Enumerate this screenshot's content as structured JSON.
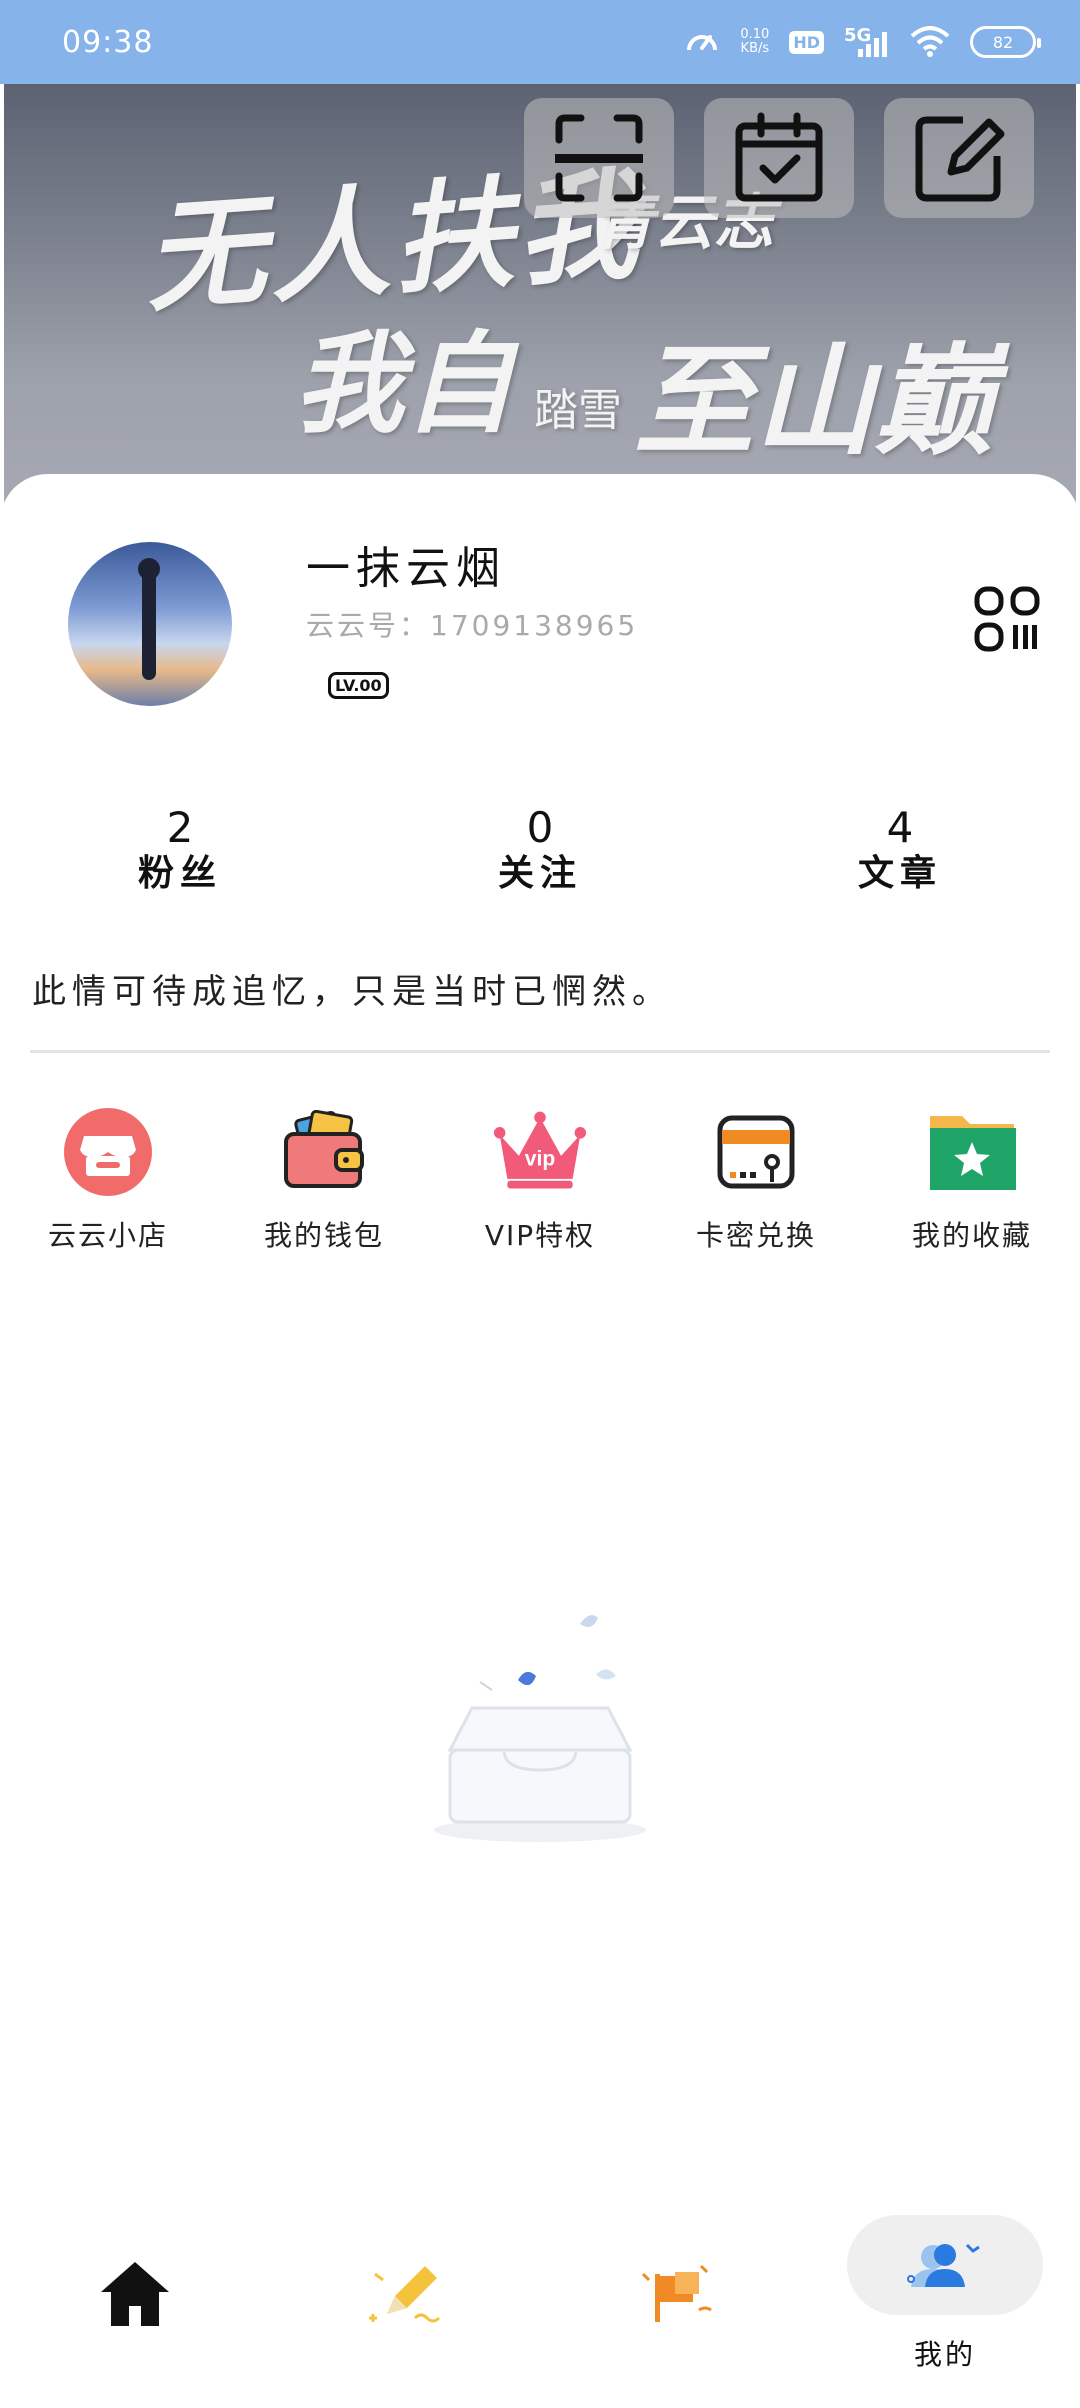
{
  "status_bar": {
    "time": "09:38",
    "net_speed": "0.10",
    "net_unit": "KB/s",
    "hd_badge": "HD",
    "network": "5G",
    "battery": "82"
  },
  "banner": {
    "line1": "无人扶我",
    "line1_small": "青云志",
    "line2": "我自",
    "line2_small": "踏雪",
    "line3": "至山巅"
  },
  "top_actions": [
    {
      "icon": "scan-icon"
    },
    {
      "icon": "calendar-check-icon"
    },
    {
      "icon": "edit-icon"
    }
  ],
  "profile": {
    "name": "一抹云烟",
    "uid": "云云号：1709138965",
    "level": "LV.00"
  },
  "stats": [
    {
      "value": "2",
      "label": "粉丝"
    },
    {
      "value": "0",
      "label": "关注"
    },
    {
      "value": "4",
      "label": "文章"
    }
  ],
  "motto": "此情可待成追忆，只是当时已惘然。",
  "menu": [
    {
      "label": "云云小店",
      "icon": "shop-icon",
      "color": "#f26b6b"
    },
    {
      "label": "我的钱包",
      "icon": "wallet-icon",
      "color": "#f07a7a"
    },
    {
      "label": "VIP特权",
      "icon": "crown-icon",
      "color": "#f25a7a"
    },
    {
      "label": "卡密兑换",
      "icon": "card-redeem-icon",
      "color": "#f08a24"
    },
    {
      "label": "我的收藏",
      "icon": "star-folder-icon",
      "color": "#1ea466"
    }
  ],
  "tabbar": {
    "tabs": [
      {
        "icon": "home-icon",
        "label": ""
      },
      {
        "icon": "pencil-icon",
        "label": ""
      },
      {
        "icon": "flag-icon",
        "label": ""
      },
      {
        "icon": "user-icon",
        "label": "我的"
      }
    ]
  }
}
